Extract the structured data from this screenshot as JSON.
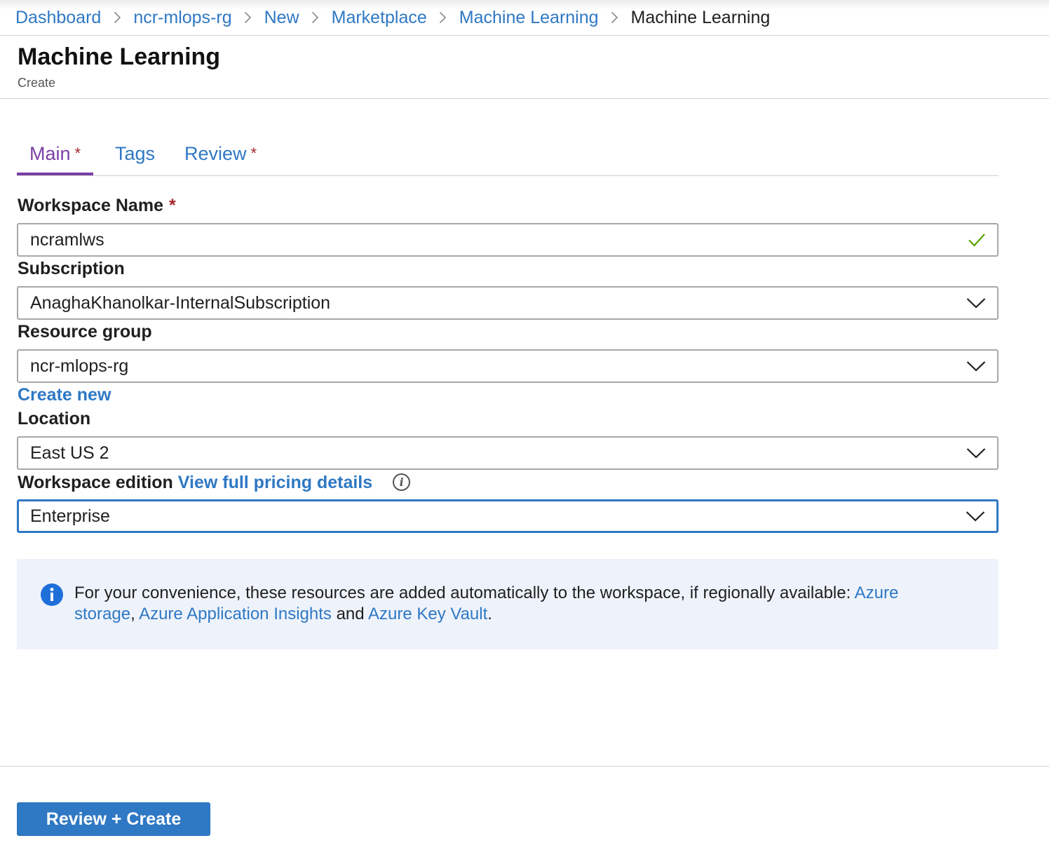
{
  "breadcrumb": {
    "items": [
      "Dashboard",
      "ncr-mlops-rg",
      "New",
      "Marketplace",
      "Machine Learning"
    ],
    "current": "Machine Learning"
  },
  "header": {
    "title": "Machine Learning",
    "subtitle": "Create"
  },
  "tabs": [
    {
      "label": "Main",
      "required": "*",
      "active": true
    },
    {
      "label": "Tags",
      "required": "",
      "active": false
    },
    {
      "label": "Review",
      "required": "*",
      "active": false
    }
  ],
  "form": {
    "workspace_name": {
      "label": "Workspace Name",
      "required": "*",
      "value": "ncramlws",
      "status_icon": "checkmark-icon"
    },
    "subscription": {
      "label": "Subscription",
      "value": "AnaghaKhanolkar-InternalSubscription"
    },
    "resource_group": {
      "label": "Resource group",
      "value": "ncr-mlops-rg",
      "create_new": "Create new"
    },
    "location": {
      "label": "Location",
      "value": "East US 2"
    },
    "workspace_edition": {
      "label": "Workspace edition",
      "pricing_link": "View full pricing details",
      "value": "Enterprise"
    }
  },
  "info": {
    "prefix": "For your convenience, these resources are added automatically to the workspace, if regionally available: ",
    "link1": "Azure storage",
    "sep1": ", ",
    "link2": "Azure Application Insights",
    "sep2": " and ",
    "link3": "Azure Key Vault",
    "suffix": "."
  },
  "footer": {
    "primary_button": "Review + Create"
  },
  "colors": {
    "link": "#2f78c4",
    "active_tab": "#7a3fa6",
    "required": "#a4262c",
    "success": "#57a300",
    "info_bg": "#eef3fb"
  }
}
